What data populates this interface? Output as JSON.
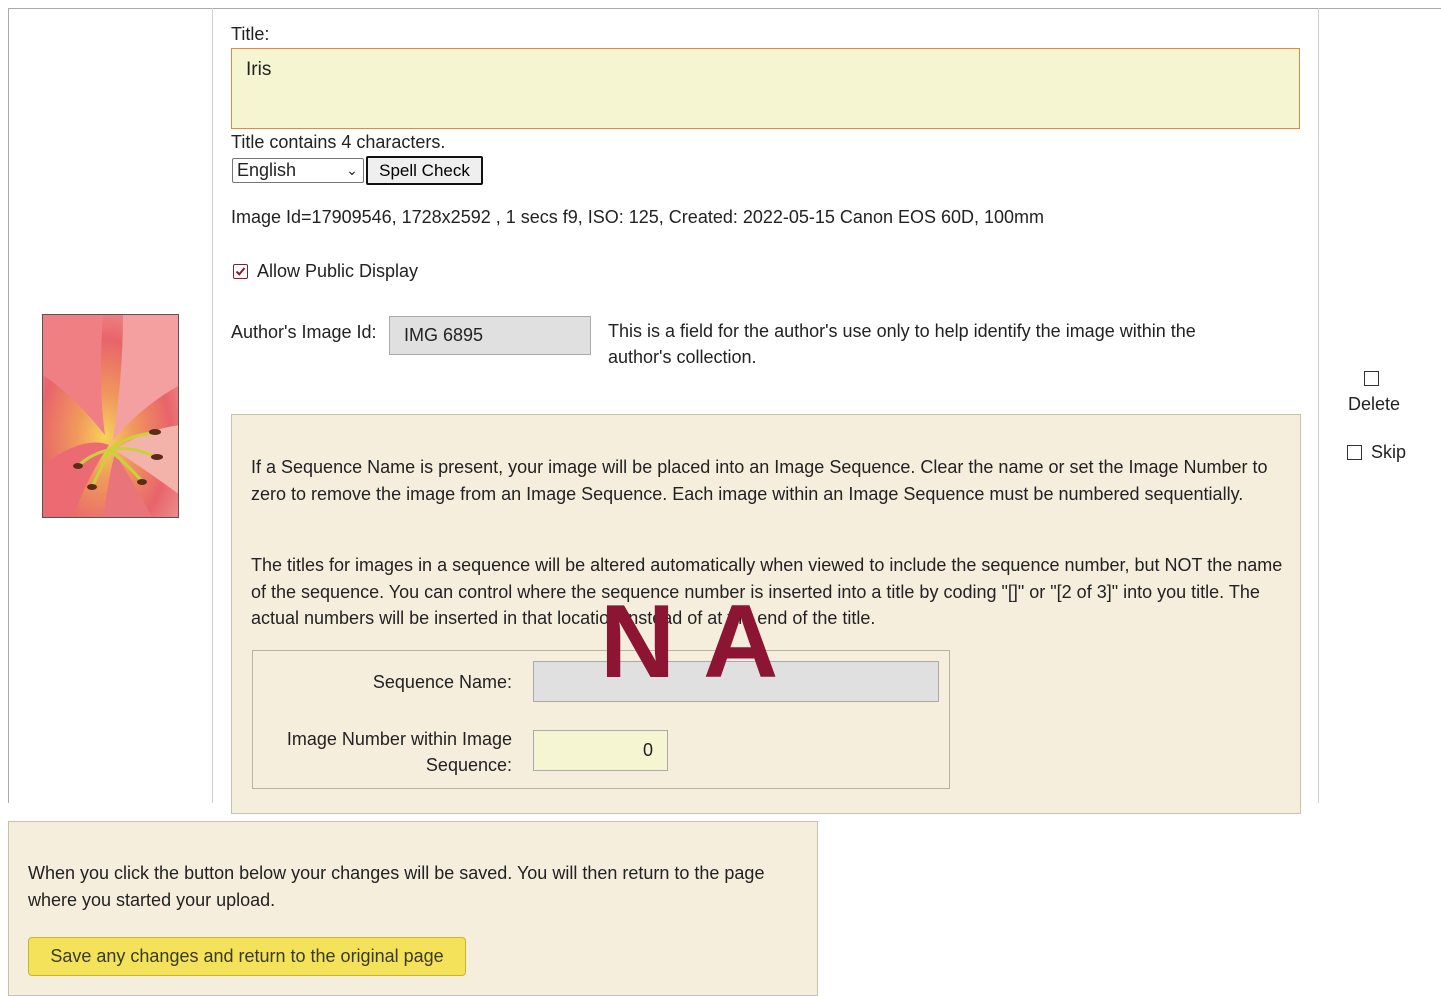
{
  "title_field": {
    "label": "Title:",
    "value": "Iris",
    "char_count_text": "Title contains 4 characters."
  },
  "language": {
    "selected": "English"
  },
  "spell_check_label": "Spell Check",
  "image_meta": "Image Id=17909546, 1728x2592 , 1 secs f9, ISO: 125, Created: 2022-05-15 Canon EOS 60D, 100mm",
  "allow_public": {
    "label": "Allow Public Display",
    "checked": true
  },
  "author": {
    "label": "Author's Image Id:",
    "value": "IMG 6895",
    "help": "This is a field for the author's use only to help identify the image within the author's collection."
  },
  "sequence": {
    "para1": "If a Sequence Name is present, your image will be placed into an Image Sequence. Clear the name or set the Image Number to zero to remove the image from an Image Sequence. Each image within an Image Sequence must be numbered sequentially.",
    "para2": "The titles for images in a sequence will be altered automatically when viewed to include the sequence number, but NOT the name of the sequence. You can control where the sequence number is inserted into a title by coding \"[]\" or \"[2 of 3]\" into you title. The actual numbers will be inserted in that location instead of at the end of the title.",
    "overlay_text": "NA",
    "name_label": "Sequence Name:",
    "name_value": "",
    "number_label": "Image Number within Image Sequence:",
    "number_value": "0"
  },
  "actions": {
    "delete_label": "Delete",
    "skip_label": "Skip"
  },
  "footer": {
    "text": "When you click the button below your changes will be saved. You will then return to the page where you started your upload.",
    "save_label": "Save any changes and return to the original page"
  },
  "colors": {
    "title_bg": "#f5f5d1",
    "panel_bg": "#f6eedd",
    "overlay": "#8b1533",
    "save_button": "#f4e35a"
  }
}
